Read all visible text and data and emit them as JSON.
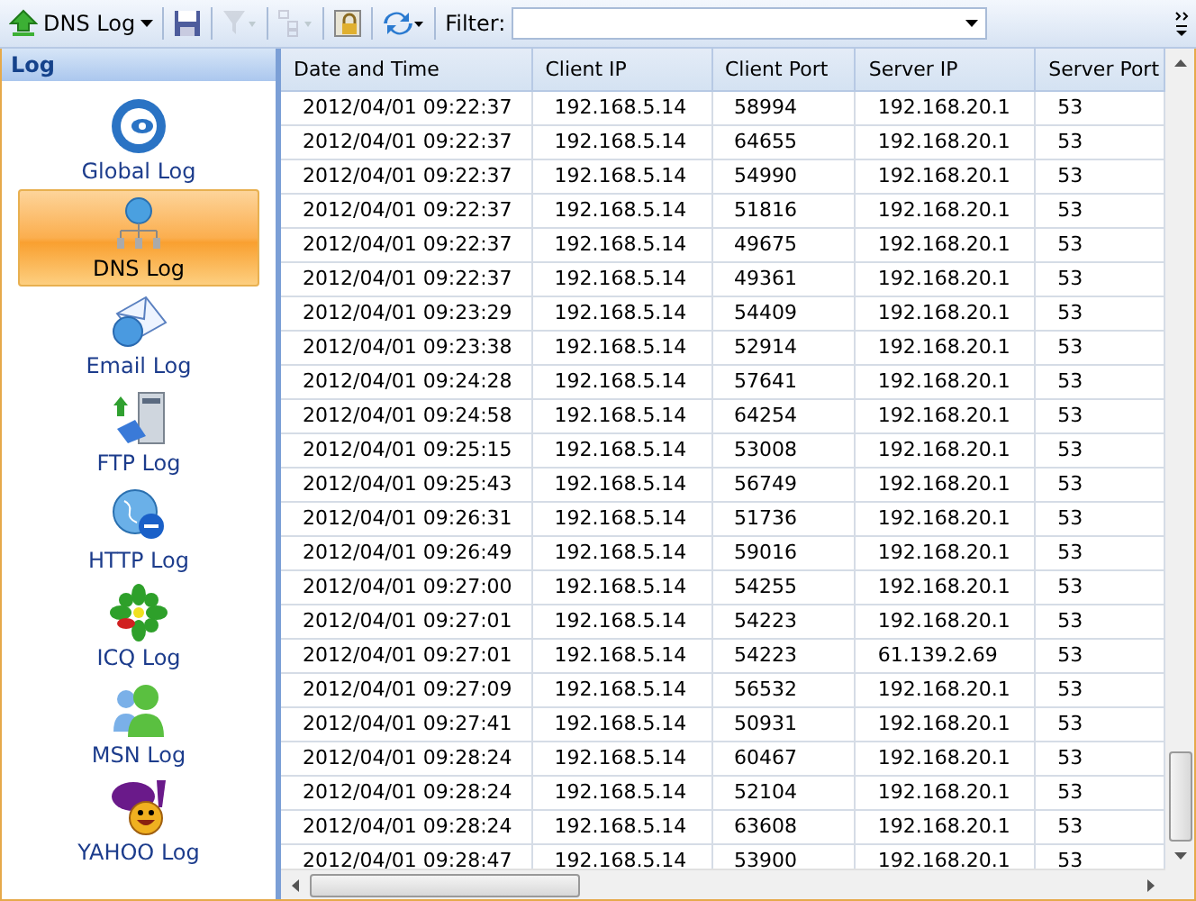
{
  "toolbar": {
    "log_menu": {
      "label": "DNS Log"
    },
    "buttons": [
      {
        "kind": "save",
        "disabled": false
      },
      {
        "kind": "filter",
        "disabled": true
      },
      {
        "kind": "tree",
        "disabled": true
      },
      {
        "kind": "lock",
        "disabled": false
      },
      {
        "kind": "refresh",
        "disabled": false
      }
    ],
    "filter_label": "Filter:"
  },
  "sidebar": {
    "title": "Log",
    "items": [
      {
        "kind": "global",
        "label": "Global Log",
        "selected": false
      },
      {
        "kind": "dns",
        "label": "DNS Log",
        "selected": true
      },
      {
        "kind": "email",
        "label": "Email Log",
        "selected": false
      },
      {
        "kind": "ftp",
        "label": "FTP Log",
        "selected": false
      },
      {
        "kind": "http",
        "label": "HTTP Log",
        "selected": false
      },
      {
        "kind": "icq",
        "label": "ICQ Log",
        "selected": false
      },
      {
        "kind": "msn",
        "label": "MSN Log",
        "selected": false
      },
      {
        "kind": "yahoo",
        "label": "YAHOO Log",
        "selected": false
      }
    ]
  },
  "table": {
    "columns": [
      "Date and Time",
      "Client IP",
      "Client Port",
      "Server IP",
      "Server Port"
    ],
    "rows": [
      [
        "2012/04/01 09:22:37",
        "192.168.5.14",
        "58994",
        "192.168.20.1",
        "53"
      ],
      [
        "2012/04/01 09:22:37",
        "192.168.5.14",
        "64655",
        "192.168.20.1",
        "53"
      ],
      [
        "2012/04/01 09:22:37",
        "192.168.5.14",
        "54990",
        "192.168.20.1",
        "53"
      ],
      [
        "2012/04/01 09:22:37",
        "192.168.5.14",
        "51816",
        "192.168.20.1",
        "53"
      ],
      [
        "2012/04/01 09:22:37",
        "192.168.5.14",
        "49675",
        "192.168.20.1",
        "53"
      ],
      [
        "2012/04/01 09:22:37",
        "192.168.5.14",
        "49361",
        "192.168.20.1",
        "53"
      ],
      [
        "2012/04/01 09:23:29",
        "192.168.5.14",
        "54409",
        "192.168.20.1",
        "53"
      ],
      [
        "2012/04/01 09:23:38",
        "192.168.5.14",
        "52914",
        "192.168.20.1",
        "53"
      ],
      [
        "2012/04/01 09:24:28",
        "192.168.5.14",
        "57641",
        "192.168.20.1",
        "53"
      ],
      [
        "2012/04/01 09:24:58",
        "192.168.5.14",
        "64254",
        "192.168.20.1",
        "53"
      ],
      [
        "2012/04/01 09:25:15",
        "192.168.5.14",
        "53008",
        "192.168.20.1",
        "53"
      ],
      [
        "2012/04/01 09:25:43",
        "192.168.5.14",
        "56749",
        "192.168.20.1",
        "53"
      ],
      [
        "2012/04/01 09:26:31",
        "192.168.5.14",
        "51736",
        "192.168.20.1",
        "53"
      ],
      [
        "2012/04/01 09:26:49",
        "192.168.5.14",
        "59016",
        "192.168.20.1",
        "53"
      ],
      [
        "2012/04/01 09:27:00",
        "192.168.5.14",
        "54255",
        "192.168.20.1",
        "53"
      ],
      [
        "2012/04/01 09:27:01",
        "192.168.5.14",
        "54223",
        "192.168.20.1",
        "53"
      ],
      [
        "2012/04/01 09:27:01",
        "192.168.5.14",
        "54223",
        "61.139.2.69",
        "53"
      ],
      [
        "2012/04/01 09:27:09",
        "192.168.5.14",
        "56532",
        "192.168.20.1",
        "53"
      ],
      [
        "2012/04/01 09:27:41",
        "192.168.5.14",
        "50931",
        "192.168.20.1",
        "53"
      ],
      [
        "2012/04/01 09:28:24",
        "192.168.5.14",
        "60467",
        "192.168.20.1",
        "53"
      ],
      [
        "2012/04/01 09:28:24",
        "192.168.5.14",
        "52104",
        "192.168.20.1",
        "53"
      ],
      [
        "2012/04/01 09:28:24",
        "192.168.5.14",
        "63608",
        "192.168.20.1",
        "53"
      ],
      [
        "2012/04/01 09:28:47",
        "192.168.5.14",
        "53900",
        "192.168.20.1",
        "53"
      ]
    ]
  }
}
